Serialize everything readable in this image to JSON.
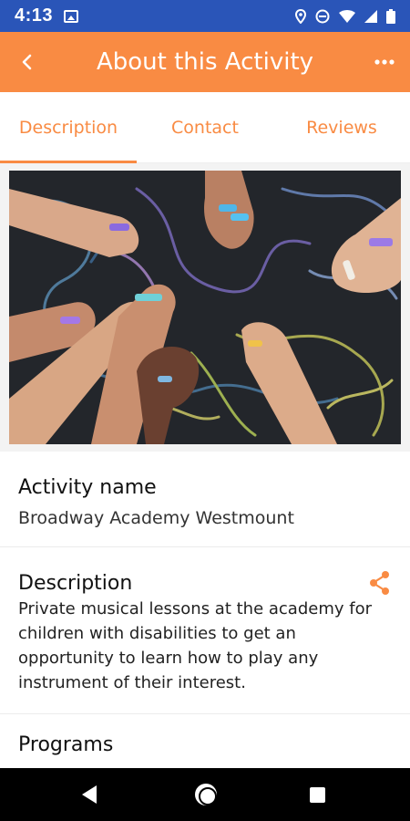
{
  "status_bar": {
    "time": "4:13",
    "icons": [
      "photo-icon",
      "location-icon",
      "do-not-disturb-icon",
      "wifi-icon",
      "signal-icon",
      "battery-icon"
    ],
    "background": "#2a55b8"
  },
  "app_bar": {
    "title": "About this Activity",
    "back_icon": "back-chevron-icon",
    "menu_icon": "more-dots-icon",
    "background": "#f98b43"
  },
  "tabs": [
    {
      "label": "Description",
      "active": true
    },
    {
      "label": "Contact",
      "active": false
    },
    {
      "label": "Reviews",
      "active": false
    }
  ],
  "hero_image": {
    "description_icon": "photo-chalk-hands"
  },
  "activity_name": {
    "title": "Activity name",
    "value": "Broadway Academy Westmount"
  },
  "description": {
    "title": "Description",
    "text": "Private musical lessons at the academy for children with disabilities to get an opportunity to learn how to play any instrument of their interest.",
    "share_icon": "share-icon"
  },
  "programs": {
    "title": "Programs"
  },
  "nav_bar": {
    "icons": [
      "nav-back-icon",
      "nav-home-icon",
      "nav-recents-icon"
    ]
  },
  "colors": {
    "accent": "#f98b43",
    "status_bar": "#2a55b8"
  }
}
